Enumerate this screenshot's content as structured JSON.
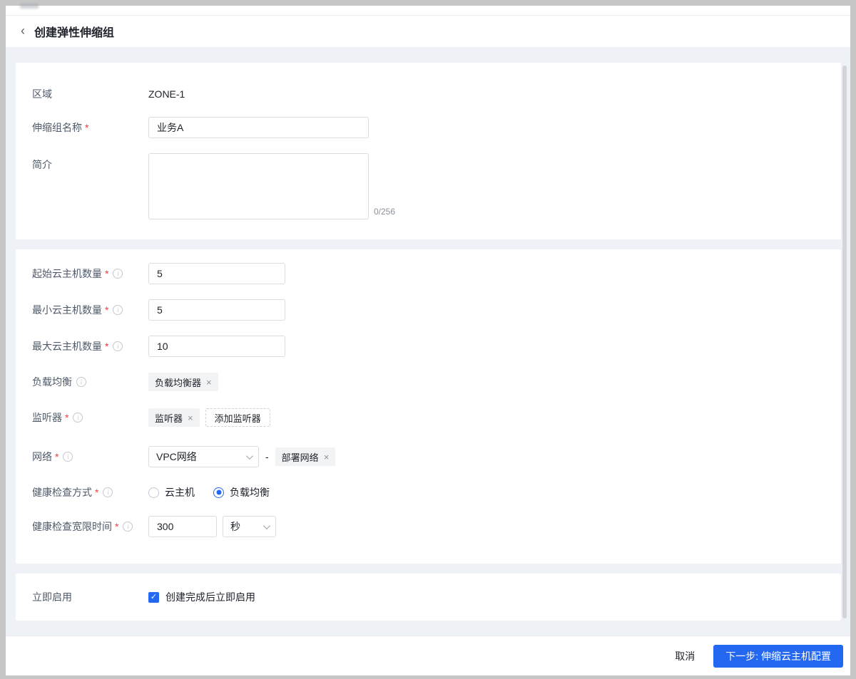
{
  "header": {
    "title": "创建弹性伸缩组"
  },
  "icons": {
    "back": "‹",
    "close": "×",
    "required_mark": "*",
    "info": "i",
    "check": "✓"
  },
  "colors": {
    "accent": "#2468f2",
    "required_mark": "#f23c3c",
    "page_background": "#eef1f6",
    "tag_background": "#f2f3f5"
  },
  "form": {
    "region": {
      "label": "区域",
      "value": "ZONE-1"
    },
    "group_name": {
      "label": "伸缩组名称",
      "value": "业务A"
    },
    "description": {
      "label": "简介",
      "value": "",
      "counter": "0/256"
    },
    "initial_vm_count": {
      "label": "起始云主机数量",
      "value": "5"
    },
    "min_vm_count": {
      "label": "最小云主机数量",
      "value": "5"
    },
    "max_vm_count": {
      "label": "最大云主机数量",
      "value": "10"
    },
    "load_balancer": {
      "label": "负载均衡",
      "tag": "负载均衡器"
    },
    "listener": {
      "label": "监听器",
      "tag": "监听器",
      "add_button": "添加监听器"
    },
    "network": {
      "label": "网络",
      "selected": "VPC网络",
      "separator": "-",
      "tag": "部署网络"
    },
    "health_check_mode": {
      "label": "健康检查方式",
      "options": [
        {
          "label": "云主机",
          "selected": false
        },
        {
          "label": "负载均衡",
          "selected": true
        }
      ]
    },
    "grace_period": {
      "label": "健康检查宽限时间",
      "value": "300",
      "unit": "秒"
    },
    "enable_now": {
      "label": "立即启用",
      "checkbox_label": "创建完成后立即启用",
      "checked": true
    }
  },
  "footer": {
    "cancel_label": "取消",
    "next_label": "下一步: 伸缩云主机配置"
  }
}
